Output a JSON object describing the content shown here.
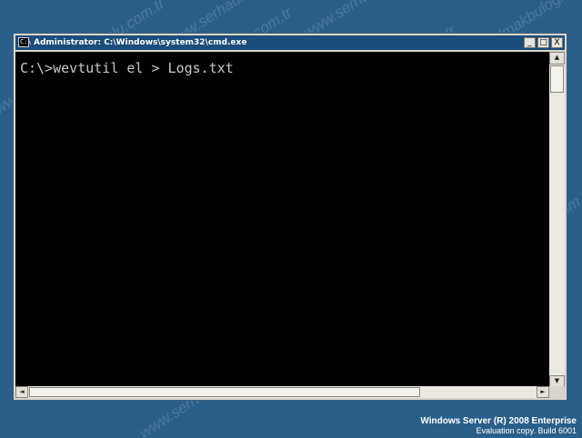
{
  "window": {
    "title": "Administrator: C:\\Windows\\system32\\cmd.exe",
    "icon": "cmd-icon",
    "icon_glyph": "C:\\",
    "buttons": {
      "minimize": "_",
      "maximize": "□",
      "close": "X"
    }
  },
  "console": {
    "lines": [
      "C:\\>wevtutil el > Logs.txt"
    ],
    "text_color": "#c8c8c8",
    "background": "#000000"
  },
  "desktop": {
    "background": "#2a5f8a",
    "watermark_text": "www.serhadmakbuloglu.com.tr",
    "branding": {
      "line1": "Windows Server (R) 2008 Enterprise",
      "line2": "Evaluation copy. Build 6001"
    }
  },
  "scrollbars": {
    "up": "▲",
    "down": "▼",
    "left": "◄",
    "right": "►"
  }
}
